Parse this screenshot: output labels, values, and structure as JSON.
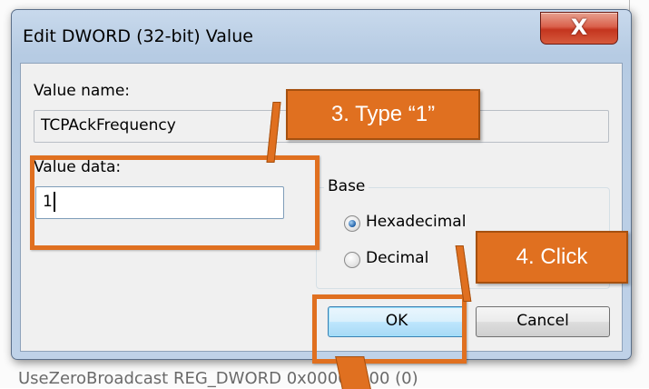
{
  "dialog": {
    "title": "Edit DWORD (32-bit) Value",
    "close_glyph": "X",
    "value_name_label": "Value name:",
    "value_name": "TCPAckFrequency",
    "value_data_label": "Value data:",
    "value_data": "1",
    "base_label": "Base",
    "base_options": [
      {
        "label": "Hexadecimal",
        "selected": true
      },
      {
        "label": "Decimal",
        "selected": false
      }
    ],
    "ok_label": "OK",
    "cancel_label": "Cancel"
  },
  "annotations": {
    "step3": "3.   Type “1”",
    "step4": "4.   Click",
    "color": "#e07020"
  },
  "background": {
    "bottom_row": "UseZeroBroadcast    REG_DWORD    0x00000000 (0)"
  }
}
